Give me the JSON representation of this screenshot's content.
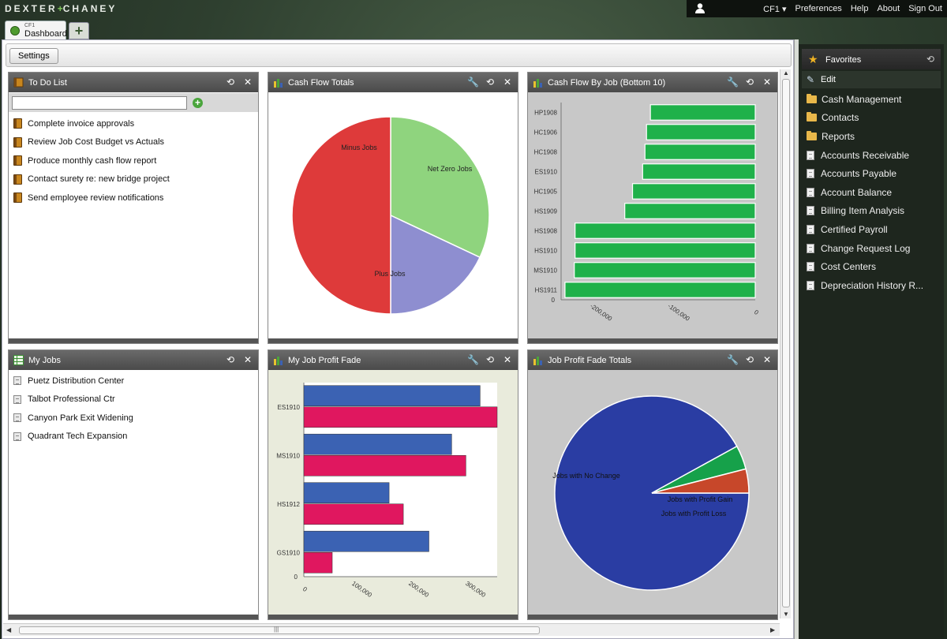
{
  "brand": {
    "left": "DEXTER",
    "plus": "+",
    "right": "CHANEY"
  },
  "topmenu": {
    "company": "CF1 ▾",
    "preferences": "Preferences",
    "help": "Help",
    "about": "About",
    "signout": "Sign Out"
  },
  "tabs": [
    {
      "sub": "CF1",
      "label": "Dashboard"
    }
  ],
  "add_tab_label": "+",
  "toolbar": {
    "settings": "Settings"
  },
  "todo": {
    "title": "To Do List",
    "items": [
      "Complete invoice approvals",
      "Review Job Cost Budget vs Actuals",
      "Produce monthly cash flow report",
      "Contact surety re: new bridge project",
      "Send employee review notifications"
    ]
  },
  "myjobs": {
    "title": "My Jobs",
    "items": [
      "Puetz Distribution Center",
      "Talbot Professional Ctr",
      "Canyon Park Exit Widening",
      "Quadrant Tech Expansion"
    ]
  },
  "panel_titles": {
    "cash_flow_totals": "Cash Flow Totals",
    "cash_flow_by_job": "Cash Flow By Job (Bottom 10)",
    "my_job_profit_fade": "My Job Profit Fade",
    "job_profit_fade_totals": "Job Profit Fade Totals"
  },
  "favorites": {
    "title": "Favorites",
    "edit": "Edit",
    "folders": [
      "Cash Management",
      "Contacts",
      "Reports"
    ],
    "reports": [
      "Accounts Receivable",
      "Accounts Payable",
      "Account Balance",
      "Billing Item Analysis",
      "Certified Payroll",
      "Change Request Log",
      "Cost Centers",
      "Depreciation History R..."
    ]
  },
  "scroll": {
    "grip": "|||"
  },
  "colors": {
    "accent": "#4e9a2e",
    "header": "#555555",
    "sidebar": "#1e261e"
  },
  "chart_data": [
    {
      "type": "pie",
      "slices": [
        {
          "name": "Minus Jobs",
          "value": 32,
          "color": "#8fd47e"
        },
        {
          "name": "Net Zero Jobs",
          "value": 18,
          "color": "#8e8ed0"
        },
        {
          "name": "Plus Jobs",
          "value": 50,
          "color": "#de3a3a"
        }
      ]
    },
    {
      "type": "bar",
      "orientation": "horizontal",
      "categories": [
        "HP1908",
        "HC1906",
        "HC1908",
        "ES1910",
        "HC1905",
        "HS1909",
        "HS1908",
        "HS1910",
        "MS1910",
        "HS1911"
      ],
      "values": [
        -135000,
        -140000,
        -142000,
        -145000,
        -158000,
        -168000,
        -232000,
        -232000,
        -233000,
        -245000
      ],
      "xticks": [
        "-200,000",
        "-100,000",
        "0"
      ],
      "ytick_zero": "0",
      "xlim": [
        -250000,
        0
      ],
      "color": "#1fb14a"
    },
    {
      "type": "bar",
      "orientation": "horizontal",
      "categories": [
        "ES1910",
        "MS1910",
        "HS1912",
        "GS1910"
      ],
      "series": [
        {
          "values": [
            310000,
            260000,
            150000,
            220000
          ],
          "color": "#3b62b3"
        },
        {
          "values": [
            340000,
            285000,
            175000,
            50000
          ],
          "color": "#e0175f"
        }
      ],
      "xticks": [
        "0",
        "100,000",
        "200,000",
        "300,000"
      ],
      "ytick_zero": "0",
      "xlim": [
        0,
        340000
      ]
    },
    {
      "type": "pie",
      "slices": [
        {
          "name": "Jobs with No Change",
          "value": 92,
          "color": "#2a3da3"
        },
        {
          "name": "Jobs with Profit Gain",
          "value": 4,
          "color": "#16a14a"
        },
        {
          "name": "Jobs with Profit Loss",
          "value": 4,
          "color": "#c7472a"
        }
      ]
    }
  ]
}
